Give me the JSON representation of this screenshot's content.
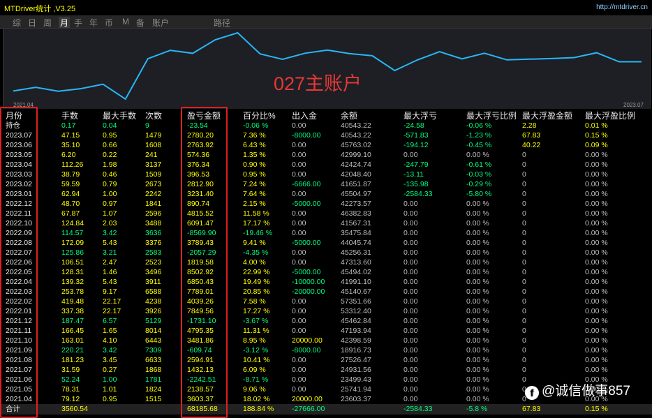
{
  "app": {
    "title": "MTDriver统计 ,V3.25",
    "url": "http://mtdriver.cn"
  },
  "tabs": [
    {
      "label": "综",
      "active": false
    },
    {
      "label": "日",
      "active": false
    },
    {
      "label": "周",
      "active": false
    },
    {
      "label": "月",
      "active": true
    },
    {
      "label": "手",
      "active": false
    },
    {
      "label": "年",
      "active": false
    },
    {
      "label": "币",
      "active": false
    },
    {
      "label": "M",
      "active": false
    },
    {
      "label": "备",
      "active": false
    },
    {
      "label": "账户",
      "active": false
    },
    {
      "label": "路径",
      "active": false
    }
  ],
  "chart": {
    "watermark": "027主账户",
    "start_label": "2021.04",
    "end_label": "2023.07",
    "line_color": "#29b6f6",
    "equity": [
      23603.37,
      25741.94,
      23499.43,
      24931.56,
      27526.47,
      18916.73,
      42398.59,
      47193.94,
      45462.84,
      53312.4,
      57351.66,
      45140.67,
      41991.1,
      45494.02,
      47313.6,
      45256.31,
      44045.74,
      35475.84,
      41567.31,
      46382.83,
      42273.57,
      45504.97,
      41651.87,
      42048.4,
      42424.74,
      42999.1,
      45763.02,
      40543.22,
      40543.22
    ]
  },
  "table": {
    "headers": [
      "月份",
      "手数",
      "最大手数",
      "次数",
      "盈亏金额",
      "百分比%",
      "出入金",
      "余额",
      "最大浮亏",
      "最大浮亏比例",
      "最大浮盈金额",
      "最大浮盈比例"
    ],
    "rows": [
      [
        "持仓",
        "0.17",
        "0.04",
        "9",
        "-23.54",
        "-0.06 %",
        "0.00",
        "40543.22",
        "-24.58",
        "-0.06 %",
        "2.28",
        "0.01 %"
      ],
      [
        "2023.07",
        "47.15",
        "0.95",
        "1479",
        "2780.20",
        "7.36 %",
        "-8000.00",
        "40543.22",
        "-571.83",
        "-1.23 %",
        "67.83",
        "0.15 %"
      ],
      [
        "2023.06",
        "35.10",
        "0.66",
        "1608",
        "2763.92",
        "6.43 %",
        "0.00",
        "45763.02",
        "-194.12",
        "-0.45 %",
        "40.22",
        "0.09 %"
      ],
      [
        "2023.05",
        "6.20",
        "0.22",
        "241",
        "574.36",
        "1.35 %",
        "0.00",
        "42999.10",
        "0.00",
        "0.00 %",
        "0",
        "0.00 %"
      ],
      [
        "2023.04",
        "112.26",
        "1.98",
        "3137",
        "376.34",
        "0.90 %",
        "0.00",
        "42424.74",
        "-247.79",
        "-0.61 %",
        "0",
        "0.00 %"
      ],
      [
        "2023.03",
        "38.79",
        "0.46",
        "1509",
        "396.53",
        "0.95 %",
        "0.00",
        "42048.40",
        "-13.11",
        "-0.03 %",
        "0",
        "0.00 %"
      ],
      [
        "2023.02",
        "59.59",
        "0.79",
        "2673",
        "2812.90",
        "7.24 %",
        "-6666.00",
        "41651.87",
        "-135.98",
        "-0.29 %",
        "0",
        "0.00 %"
      ],
      [
        "2023.01",
        "62.94",
        "1.00",
        "2242",
        "3231.40",
        "7.64 %",
        "0.00",
        "45504.97",
        "-2584.33",
        "-5.80 %",
        "0",
        "0.00 %"
      ],
      [
        "2022.12",
        "48.70",
        "0.97",
        "1841",
        "890.74",
        "2.15 %",
        "-5000.00",
        "42273.57",
        "0.00",
        "0.00 %",
        "0",
        "0.00 %"
      ],
      [
        "2022.11",
        "67.87",
        "1.07",
        "2596",
        "4815.52",
        "11.58 %",
        "0.00",
        "46382.83",
        "0.00",
        "0.00 %",
        "0",
        "0.00 %"
      ],
      [
        "2022.10",
        "124.84",
        "2.03",
        "3488",
        "6091.47",
        "17.17 %",
        "0.00",
        "41567.31",
        "0.00",
        "0.00 %",
        "0",
        "0.00 %"
      ],
      [
        "2022.09",
        "114.57",
        "3.42",
        "3636",
        "-8569.90",
        "-19.46 %",
        "0.00",
        "35475.84",
        "0.00",
        "0.00 %",
        "0",
        "0.00 %"
      ],
      [
        "2022.08",
        "172.09",
        "5.43",
        "3376",
        "3789.43",
        "9.41 %",
        "-5000.00",
        "44045.74",
        "0.00",
        "0.00 %",
        "0",
        "0.00 %"
      ],
      [
        "2022.07",
        "125.86",
        "3.21",
        "2583",
        "-2057.29",
        "-4.35 %",
        "0.00",
        "45256.31",
        "0.00",
        "0.00 %",
        "0",
        "0.00 %"
      ],
      [
        "2022.06",
        "106.51",
        "2.47",
        "2523",
        "1819.58",
        "4.00 %",
        "0.00",
        "47313.60",
        "0.00",
        "0.00 %",
        "0",
        "0.00 %"
      ],
      [
        "2022.05",
        "128.31",
        "1.46",
        "3496",
        "8502.92",
        "22.99 %",
        "-5000.00",
        "45494.02",
        "0.00",
        "0.00 %",
        "0",
        "0.00 %"
      ],
      [
        "2022.04",
        "139.32",
        "5.43",
        "3911",
        "6850.43",
        "19.49 %",
        "-10000.00",
        "41991.10",
        "0.00",
        "0.00 %",
        "0",
        "0.00 %"
      ],
      [
        "2022.03",
        "253.78",
        "9.17",
        "6588",
        "7789.01",
        "20.85 %",
        "-20000.00",
        "45140.67",
        "0.00",
        "0.00 %",
        "0",
        "0.00 %"
      ],
      [
        "2022.02",
        "419.48",
        "22.17",
        "4238",
        "4039.26",
        "7.58 %",
        "0.00",
        "57351.66",
        "0.00",
        "0.00 %",
        "0",
        "0.00 %"
      ],
      [
        "2022.01",
        "337.38",
        "22.17",
        "3926",
        "7849.56",
        "17.27 %",
        "0.00",
        "53312.40",
        "0.00",
        "0.00 %",
        "0",
        "0.00 %"
      ],
      [
        "2021.12",
        "187.47",
        "6.57",
        "5129",
        "-1731.10",
        "-3.67 %",
        "0.00",
        "45462.84",
        "0.00",
        "0.00 %",
        "0",
        "0.00 %"
      ],
      [
        "2021.11",
        "166.45",
        "1.65",
        "8014",
        "4795.35",
        "11.31 %",
        "0.00",
        "47193.94",
        "0.00",
        "0.00 %",
        "0",
        "0.00 %"
      ],
      [
        "2021.10",
        "163.01",
        "4.10",
        "6443",
        "3481.86",
        "8.95 %",
        "20000.00",
        "42398.59",
        "0.00",
        "0.00 %",
        "0",
        "0.00 %"
      ],
      [
        "2021.09",
        "220.21",
        "3.42",
        "7309",
        "-609.74",
        "-3.12 %",
        "-8000.00",
        "18916.73",
        "0.00",
        "0.00 %",
        "0",
        "0.00 %"
      ],
      [
        "2021.08",
        "181.23",
        "3.45",
        "6633",
        "2594.91",
        "10.41 %",
        "0.00",
        "27526.47",
        "0.00",
        "0.00 %",
        "0",
        "0.00 %"
      ],
      [
        "2021.07",
        "31.59",
        "0.27",
        "1868",
        "1432.13",
        "6.09 %",
        "0.00",
        "24931.56",
        "0.00",
        "0.00 %",
        "0",
        "0.00 %"
      ],
      [
        "2021.06",
        "52.24",
        "1.00",
        "1781",
        "-2242.51",
        "-8.71 %",
        "0.00",
        "23499.43",
        "0.00",
        "0.00 %",
        "0",
        "0.00 %"
      ],
      [
        "2021.05",
        "78.31",
        "1.01",
        "1824",
        "2138.57",
        "9.06 %",
        "0.00",
        "25741.94",
        "0.00",
        "0.00 %",
        "0",
        "0.00 %"
      ],
      [
        "2021.04",
        "79.12",
        "0.95",
        "1515",
        "3603.37",
        "18.02 %",
        "20000.00",
        "23603.37",
        "0.00",
        "0.00 %",
        "0",
        "0.00 %"
      ]
    ],
    "total": [
      "合计",
      "3560.54",
      "",
      "",
      "68185.68",
      "188.84 %",
      "-27666.00",
      "",
      "-2584.33",
      "-5.8 %",
      "67.83",
      "0.15 %"
    ]
  },
  "brand": {
    "logo": "f",
    "text": "@诚信做事857"
  },
  "colors": {
    "positive": "#ffff00",
    "negative": "#00ff7f",
    "highlight_box": "#e0201f"
  }
}
